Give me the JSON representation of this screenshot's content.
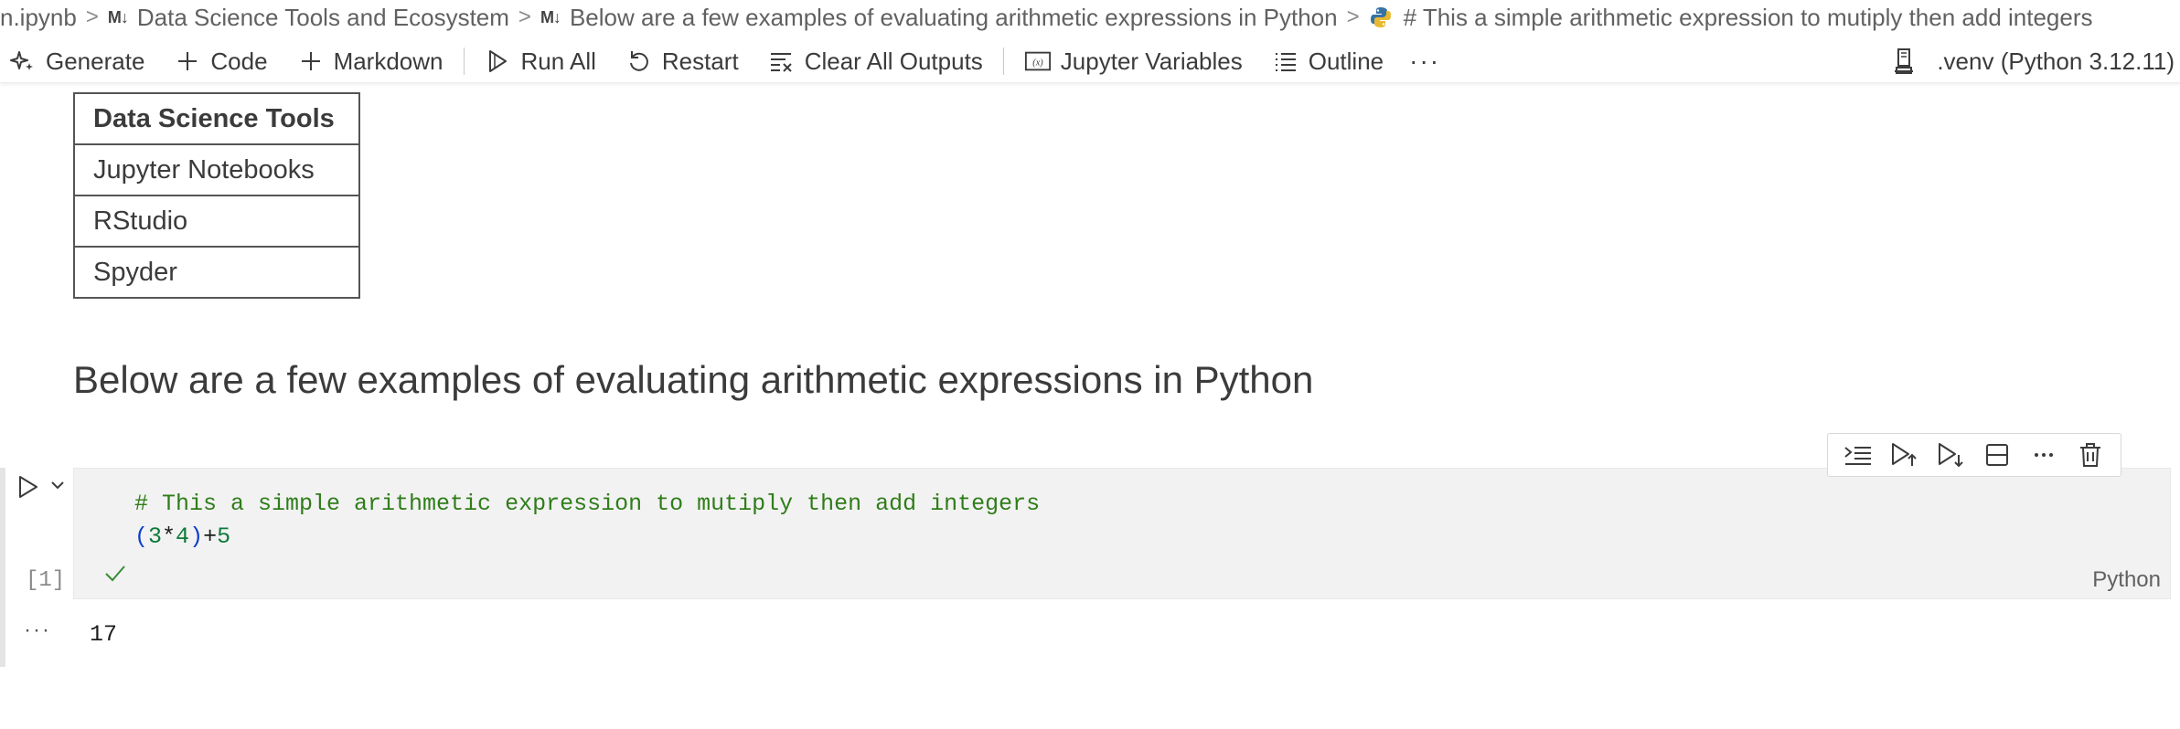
{
  "breadcrumb": {
    "file": "n.ipynb",
    "md_badge": "M↓",
    "item1": "Data Science Tools and Ecosystem",
    "item2": "Below are a few examples of evaluating arithmetic expressions in Python",
    "item3": "# This a simple arithmetic expression to mutiply then add integers"
  },
  "toolbar": {
    "generate": "Generate",
    "code": "Code",
    "markdown": "Markdown",
    "run_all": "Run All",
    "restart": "Restart",
    "clear_all_outputs": "Clear All Outputs",
    "jupyter_variables": "Jupyter Variables",
    "outline": "Outline",
    "more": "···",
    "kernel": ".venv (Python 3.12.11)"
  },
  "table": {
    "header": "Data Science Tools",
    "rows": [
      "Jupyter Notebooks",
      "RStudio",
      "Spyder"
    ]
  },
  "heading": "Below are a few examples of evaluating arithmetic expressions in Python",
  "cell": {
    "comment": "# This a simple arithmetic expression to mutiply then add integers",
    "code_tokens": [
      "(",
      "3",
      "*",
      "4",
      ")",
      "+",
      "5"
    ],
    "exec_count": "[1]",
    "language": "Python",
    "output_more": "···",
    "output": "17"
  },
  "icons": {
    "generate": "sparkle-icon",
    "code": "plus-icon",
    "markdown": "plus-icon",
    "run_all": "run-all-icon",
    "restart": "restart-icon",
    "clear": "clear-outputs-icon",
    "variables": "variables-icon",
    "outline": "outline-icon",
    "kernel": "kernel-icon"
  },
  "colors": {
    "comment": "#2f7d1a",
    "paren": "#0e3fc8",
    "number": "#0e7a3a",
    "check": "#388a34",
    "python_blue": "#3572a5"
  }
}
